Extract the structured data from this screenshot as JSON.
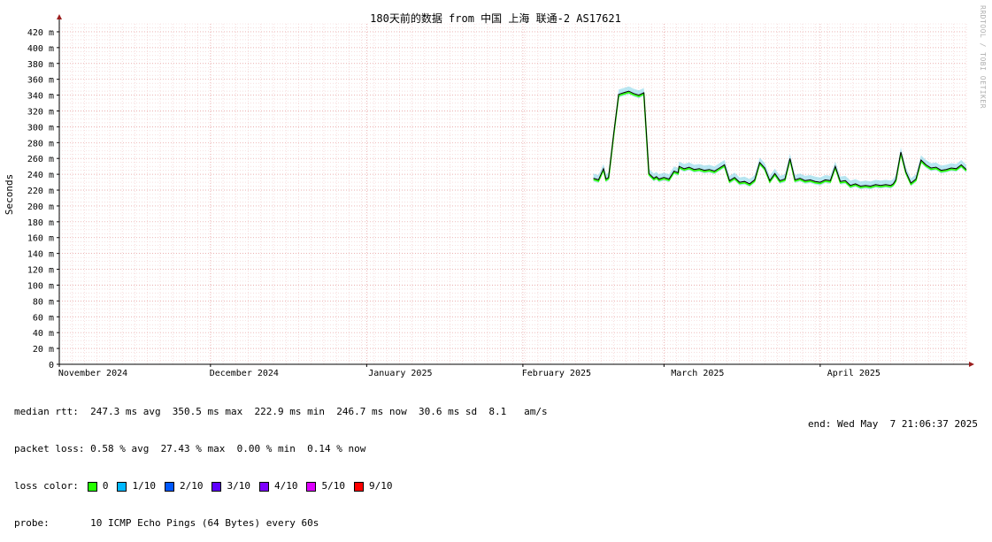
{
  "chart_data": {
    "type": "line",
    "title": "180天前的数据 from 中国 上海 联通-2 AS17621",
    "ylabel": "Seconds",
    "ylim": [
      0,
      430
    ],
    "yticks": [
      0,
      20,
      40,
      60,
      80,
      100,
      120,
      140,
      160,
      180,
      200,
      220,
      240,
      260,
      280,
      300,
      320,
      340,
      360,
      380,
      400,
      420
    ],
    "ytick_labels": [
      "0",
      "20 m",
      "40 m",
      "60 m",
      "80 m",
      "100 m",
      "120 m",
      "140 m",
      "160 m",
      "180 m",
      "200 m",
      "220 m",
      "240 m",
      "260 m",
      "280 m",
      "300 m",
      "320 m",
      "340 m",
      "360 m",
      "380 m",
      "400 m",
      "420 m"
    ],
    "x_unit": "days since first tick (Nov 2024)",
    "xlim": [
      0,
      180
    ],
    "xticks": [
      {
        "label": "November 2024",
        "x": 0
      },
      {
        "label": "December 2024",
        "x": 30
      },
      {
        "label": "January 2025",
        "x": 61
      },
      {
        "label": "February 2025",
        "x": 92
      },
      {
        "label": "March 2025",
        "x": 120
      },
      {
        "label": "April 2025",
        "x": 151
      }
    ],
    "grid": true,
    "series": [
      {
        "name": "median rtt",
        "x": [
          106,
          107,
          107.5,
          108,
          108.5,
          109,
          110,
          111,
          112,
          113,
          114,
          115,
          116,
          117,
          118,
          118.5,
          119,
          120,
          121,
          122,
          122.8,
          123,
          124,
          125,
          126,
          127,
          128,
          129,
          130,
          131,
          132,
          133,
          134,
          135,
          136,
          137,
          138,
          139,
          140,
          141,
          142,
          143,
          144,
          145,
          146,
          147,
          148,
          149,
          150,
          151,
          152,
          153,
          154,
          155,
          156,
          157,
          158,
          159,
          160,
          161,
          162,
          163,
          164,
          165,
          165.5,
          166,
          167,
          168,
          169,
          170,
          171,
          172,
          173,
          174,
          175,
          176,
          177,
          178,
          179,
          180
        ],
        "y": [
          235,
          233,
          240,
          247,
          234,
          236,
          290,
          341,
          343,
          345,
          342,
          340,
          343,
          241,
          235,
          237,
          234,
          236,
          234,
          244,
          242,
          250,
          247,
          249,
          246,
          247,
          245,
          246,
          244,
          248,
          252,
          232,
          236,
          230,
          231,
          228,
          233,
          255,
          248,
          232,
          241,
          232,
          234,
          260,
          233,
          235,
          232,
          233,
          231,
          230,
          233,
          232,
          250,
          231,
          232,
          226,
          228,
          225,
          226,
          225,
          227,
          226,
          227,
          226,
          228,
          233,
          268,
          243,
          229,
          234,
          258,
          252,
          248,
          249,
          245,
          246,
          248,
          247,
          252,
          246
        ]
      }
    ],
    "stats": {
      "median_rtt": "median rtt:  247.3 ms avg  350.5 ms max  222.9 ms min  246.7 ms now  30.6 ms sd  8.1   am/s",
      "packet_loss": "packet loss: 0.58 % avg  27.43 % max  0.00 % min  0.14 % now",
      "loss_color_label": "loss color:",
      "probe": "probe:       10 ICMP Echo Pings (64 Bytes) every 60s",
      "end": "end: Wed May  7 21:06:37 2025"
    },
    "loss_colors": [
      {
        "label": "0",
        "color": "#26ff00"
      },
      {
        "label": "1/10",
        "color": "#00b8ff"
      },
      {
        "label": "2/10",
        "color": "#0059ff"
      },
      {
        "label": "3/10",
        "color": "#5e00ff"
      },
      {
        "label": "4/10",
        "color": "#7e00ff"
      },
      {
        "label": "5/10",
        "color": "#dd00ff"
      },
      {
        "label": "9/10",
        "color": "#ff0000"
      }
    ],
    "watermark": "RRDTOOL / TOBI OETIKER"
  }
}
